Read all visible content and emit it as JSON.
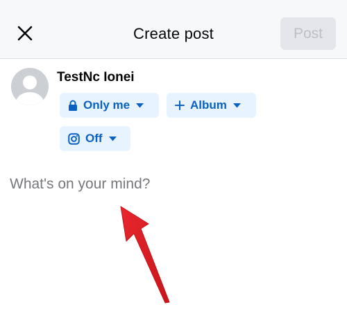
{
  "header": {
    "title": "Create post",
    "post_label": "Post",
    "close_icon": "close-icon"
  },
  "author": {
    "name": "TestNc Ionei",
    "avatar_icon": "default-avatar-icon"
  },
  "chips": {
    "privacy": {
      "label": "Only me",
      "icon": "lock-icon"
    },
    "album": {
      "label": "Album",
      "icon": "plus-icon"
    },
    "instagram": {
      "label": "Off",
      "icon": "instagram-icon"
    }
  },
  "composer": {
    "placeholder": "What's on your mind?"
  },
  "colors": {
    "accent": "#0a61c2",
    "chip_bg": "#e7f3ff",
    "annotation_arrow": "#e0242b"
  }
}
